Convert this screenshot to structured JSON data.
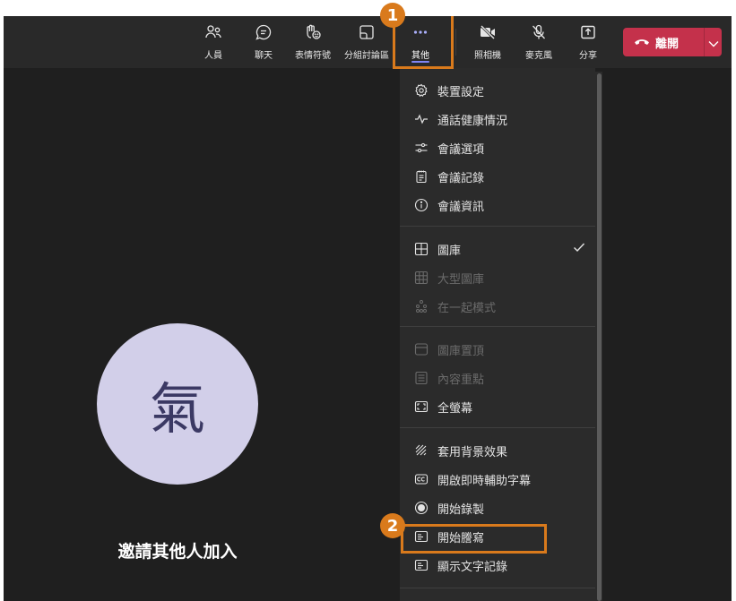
{
  "toolbar": {
    "people": {
      "label": "人員",
      "icon": "people-icon"
    },
    "chat": {
      "label": "聊天",
      "icon": "chat-icon"
    },
    "reactions": {
      "label": "表情符號",
      "icon": "reactions-icon"
    },
    "breakout": {
      "label": "分組討論區",
      "icon": "breakout-rooms-icon"
    },
    "more": {
      "label": "其他",
      "icon": "more-icon"
    },
    "camera": {
      "label": "照相機",
      "icon": "camera-off-icon"
    },
    "mic": {
      "label": "麥克風",
      "icon": "mic-off-icon"
    },
    "share": {
      "label": "分享",
      "icon": "share-icon"
    },
    "leave": {
      "label": "離開",
      "icon": "hang-up-icon"
    }
  },
  "participant": {
    "avatar_text": "氣",
    "invite_text": "邀請其他人加入"
  },
  "menu": {
    "device_settings": "裝置設定",
    "call_health": "通話健康情況",
    "meeting_options": "會議選項",
    "meeting_notes": "會議記錄",
    "meeting_info": "會議資訊",
    "gallery": "圖庫",
    "large_gallery": "大型圖庫",
    "together_mode": "在一起模式",
    "gallery_top": "圖庫置頂",
    "focus_content": "內容重點",
    "full_screen": "全螢幕",
    "background_effects": "套用背景效果",
    "live_captions": "開啟即時輔助字幕",
    "start_recording": "開始錄製",
    "start_transcription": "開始謄寫",
    "show_transcript": "顯示文字記錄"
  },
  "annotations": {
    "step1": "1",
    "step2": "2"
  },
  "colors": {
    "accent": "#7f85f5",
    "leave": "#c4314b",
    "highlight": "#d97a1c",
    "avatar_bg": "#d2cfe9"
  }
}
